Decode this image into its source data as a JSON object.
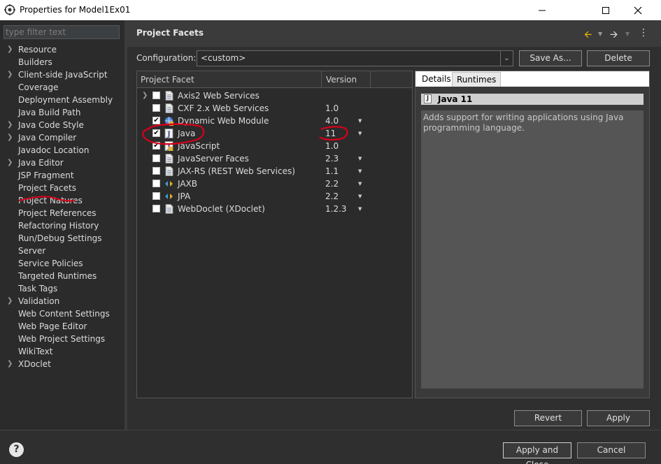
{
  "window": {
    "title": "Properties for Model1Ex01"
  },
  "sidebar": {
    "filter_placeholder": "type filter text",
    "items": [
      {
        "label": "Resource",
        "expandable": true
      },
      {
        "label": "Builders",
        "expandable": false
      },
      {
        "label": "Client-side JavaScript",
        "expandable": true
      },
      {
        "label": "Coverage",
        "expandable": false
      },
      {
        "label": "Deployment Assembly",
        "expandable": false
      },
      {
        "label": "Java Build Path",
        "expandable": false
      },
      {
        "label": "Java Code Style",
        "expandable": true
      },
      {
        "label": "Java Compiler",
        "expandable": true
      },
      {
        "label": "Javadoc Location",
        "expandable": false
      },
      {
        "label": "Java Editor",
        "expandable": true
      },
      {
        "label": "JSP Fragment",
        "expandable": false
      },
      {
        "label": "Project Facets",
        "expandable": false,
        "selected": true
      },
      {
        "label": "Project Natures",
        "expandable": false
      },
      {
        "label": "Project References",
        "expandable": false
      },
      {
        "label": "Refactoring History",
        "expandable": false
      },
      {
        "label": "Run/Debug Settings",
        "expandable": false
      },
      {
        "label": "Server",
        "expandable": false
      },
      {
        "label": "Service Policies",
        "expandable": false
      },
      {
        "label": "Targeted Runtimes",
        "expandable": false
      },
      {
        "label": "Task Tags",
        "expandable": false
      },
      {
        "label": "Validation",
        "expandable": true
      },
      {
        "label": "Web Content Settings",
        "expandable": false
      },
      {
        "label": "Web Page Editor",
        "expandable": false
      },
      {
        "label": "Web Project Settings",
        "expandable": false
      },
      {
        "label": "WikiText",
        "expandable": false
      },
      {
        "label": "XDoclet",
        "expandable": true
      }
    ]
  },
  "page": {
    "title": "Project Facets",
    "configuration_label": "Configuration:",
    "configuration_value": "<custom>",
    "save_as_label": "Save As...",
    "delete_label": "Delete"
  },
  "facets": {
    "col_facet": "Project Facet",
    "col_version": "Version",
    "rows": [
      {
        "name": "Axis2 Web Services",
        "version": "",
        "checked": false,
        "expandable": true,
        "icon": "document-icon",
        "dropdown": false
      },
      {
        "name": "CXF 2.x Web Services",
        "version": "1.0",
        "checked": false,
        "expandable": false,
        "icon": "document-icon",
        "dropdown": false
      },
      {
        "name": "Dynamic Web Module",
        "version": "4.0",
        "checked": true,
        "expandable": false,
        "icon": "web-module-icon",
        "dropdown": true
      },
      {
        "name": "Java",
        "version": "11",
        "checked": true,
        "expandable": false,
        "icon": "java-icon",
        "dropdown": true
      },
      {
        "name": "JavaScript",
        "version": "1.0",
        "checked": true,
        "expandable": false,
        "icon": "javascript-icon",
        "dropdown": false
      },
      {
        "name": "JavaServer Faces",
        "version": "2.3",
        "checked": false,
        "expandable": false,
        "icon": "document-icon",
        "dropdown": true
      },
      {
        "name": "JAX-RS (REST Web Services)",
        "version": "1.1",
        "checked": false,
        "expandable": false,
        "icon": "document-icon",
        "dropdown": true
      },
      {
        "name": "JAXB",
        "version": "2.2",
        "checked": false,
        "expandable": false,
        "icon": "diamond-arrows-icon",
        "dropdown": true
      },
      {
        "name": "JPA",
        "version": "2.2",
        "checked": false,
        "expandable": false,
        "icon": "diamond-arrows-icon",
        "dropdown": true
      },
      {
        "name": "WebDoclet (XDoclet)",
        "version": "1.2.3",
        "checked": false,
        "expandable": false,
        "icon": "document-icon",
        "dropdown": true
      }
    ]
  },
  "details": {
    "tab_details": "Details",
    "tab_runtimes": "Runtimes",
    "facet_title": "Java 11",
    "description": "Adds support for writing applications using Java programming language."
  },
  "buttons": {
    "revert": "Revert",
    "apply": "Apply",
    "apply_close": "Apply and Close",
    "cancel": "Cancel"
  },
  "colors": {
    "annotation_red": "#d9001b"
  }
}
